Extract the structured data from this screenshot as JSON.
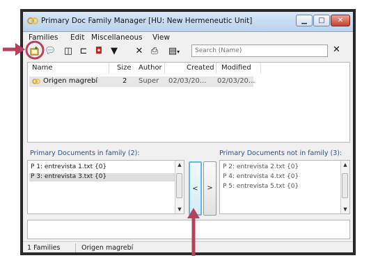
{
  "window": {
    "title": "Primary Doc Family Manager [HU: New Hermeneutic Unit]"
  },
  "menu": [
    "Families",
    "Edit",
    "Miscellaneous",
    "View"
  ],
  "toolbar": {
    "search_placeholder": "Search (Name)",
    "clear_label": "✕"
  },
  "families_table": {
    "columns": [
      "Name",
      "Size",
      "Author",
      "Created",
      "Modified"
    ],
    "rows": [
      {
        "name": "Origen magrebí",
        "size": "2",
        "author": "Super",
        "created": "02/03/20...",
        "modified": "02/03/20..."
      }
    ]
  },
  "in_family": {
    "label": "Primary Documents in family (2):",
    "items": [
      "P 1: entrevista 1.txt {0}",
      "P 3: entrevista 3.txt {0}"
    ]
  },
  "not_in_family": {
    "label": "Primary Documents not in family (3):",
    "items": [
      "P 2: entrevista 2.txt {0}",
      "P 4: entrevista 4.txt {0}",
      "P 5: entrevista 5.txt {0}"
    ]
  },
  "move_buttons": {
    "left": "<",
    "right": ">"
  },
  "status": {
    "count": "1 Families",
    "selected": "Origen magrebí"
  },
  "colors": {
    "annotation": "#b5415a",
    "highlight": "#64b7e8"
  }
}
